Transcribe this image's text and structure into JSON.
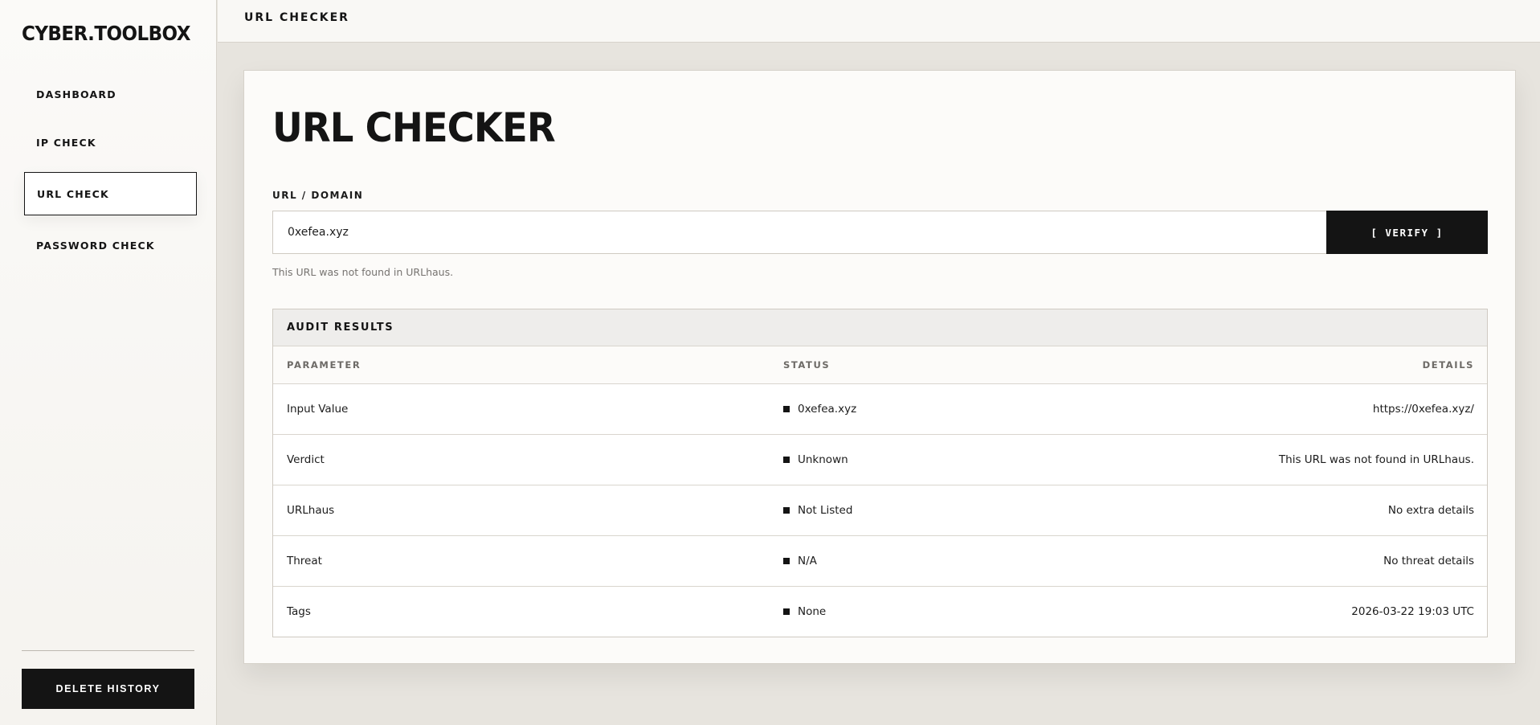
{
  "sidebar": {
    "brand": "CYBER.TOOLBOX",
    "items": [
      {
        "label": "DASHBOARD",
        "active": false
      },
      {
        "label": "IP CHECK",
        "active": false
      },
      {
        "label": "URL CHECK",
        "active": true
      },
      {
        "label": "PASSWORD CHECK",
        "active": false
      }
    ],
    "delete_label": "DELETE HISTORY"
  },
  "topbar": {
    "title": "URL CHECKER"
  },
  "main": {
    "title": "URL CHECKER",
    "field_label": "URL / DOMAIN",
    "input_value": "0xefea.xyz",
    "verify_label": "[ VERIFY ]",
    "help_text": "This URL was not found in URLhaus."
  },
  "results": {
    "title": "AUDIT RESULTS",
    "columns": [
      "PARAMETER",
      "STATUS",
      "DETAILS"
    ],
    "rows": [
      {
        "parameter": "Input Value",
        "status": "0xefea.xyz",
        "details": "https://0xefea.xyz/"
      },
      {
        "parameter": "Verdict",
        "status": "Unknown",
        "details": "This URL was not found in URLhaus."
      },
      {
        "parameter": "URLhaus",
        "status": "Not Listed",
        "details": "No extra details"
      },
      {
        "parameter": "Threat",
        "status": "N/A",
        "details": "No threat details"
      },
      {
        "parameter": "Tags",
        "status": "None",
        "details": "2026-03-22 19:03 UTC"
      }
    ]
  },
  "colors": {
    "background": "#e7e4de",
    "accent": "#141414",
    "card": "#fcfbf9"
  }
}
